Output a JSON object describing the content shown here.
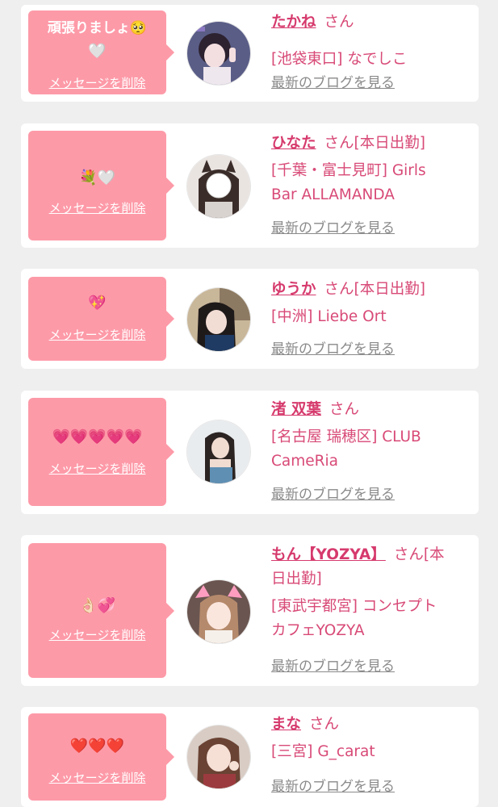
{
  "delete_label": "メッセージを削除",
  "blog_label": "最新のブログを見る",
  "san_label": "さん",
  "colors": {
    "bubble": "#fd9aa8",
    "name": "#d63a6d",
    "info": "#d84a77",
    "blog_link": "#8a8a8a",
    "background": "#efefef"
  },
  "entries": [
    {
      "message": "頑張りましょ🥺",
      "message2": "🤍",
      "name": "たかね",
      "attendance": "",
      "shop": "[池袋東口] なでしこ",
      "shop2": ""
    },
    {
      "message": "💐🤍",
      "name": "ひなた",
      "attendance": "[本日出勤]",
      "shop": "[千葉・富士見町] Girls",
      "shop2": "Bar ALLAMANDA"
    },
    {
      "message": "💖",
      "name": "ゆうか",
      "attendance": "[本日出勤]",
      "shop": "[中洲] Liebe Ort",
      "shop2": ""
    },
    {
      "message": "💗💗💗💗💗",
      "name": "渚 双葉",
      "attendance": "",
      "shop": "[名古屋 瑞穂区] CLUB",
      "shop2": "CameRia"
    },
    {
      "message": "👌🏻💞",
      "name": "もん【YOZYA】",
      "attendance": "[本",
      "attendance2": "日出勤]",
      "shop": "[東武宇都宮] コンセプト",
      "shop2": "カフェYOZYA"
    },
    {
      "message": "❤️❤️❤️",
      "name": "まな",
      "attendance": "",
      "shop": "[三宮] G_carat",
      "shop2": ""
    }
  ]
}
